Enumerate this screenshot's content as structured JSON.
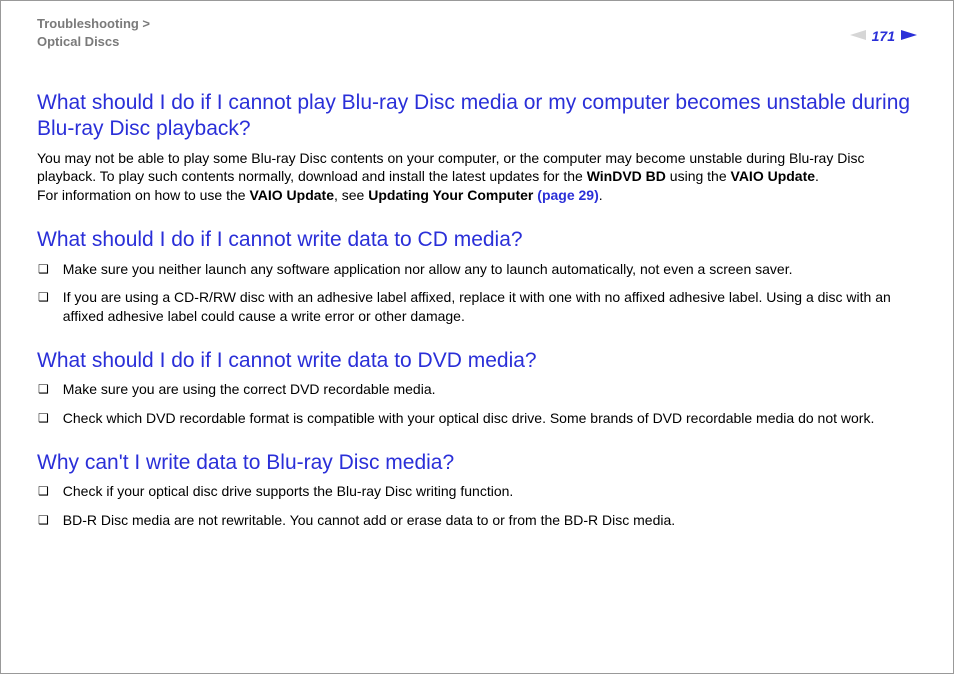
{
  "header": {
    "breadcrumb_line1": "Troubleshooting >",
    "breadcrumb_line2": "Optical Discs",
    "page_number": "171"
  },
  "sections": [
    {
      "heading": "What should I do if I cannot play Blu-ray Disc media or my computer becomes unstable during Blu-ray Disc playback?",
      "para_parts": [
        {
          "t": "You may not be able to play some Blu-ray Disc contents on your computer, or the computer may become unstable during Blu-ray Disc playback. To play such contents normally, download and install the latest updates for the "
        },
        {
          "t": "WinDVD BD",
          "bold": true
        },
        {
          "t": " using the "
        },
        {
          "t": "VAIO Update",
          "bold": true
        },
        {
          "t": "."
        },
        {
          "br": true
        },
        {
          "t": "For information on how to use the "
        },
        {
          "t": "VAIO Update",
          "bold": true
        },
        {
          "t": ", see "
        },
        {
          "t": "Updating Your Computer ",
          "bold": true
        },
        {
          "t": "(page 29)",
          "link": true
        },
        {
          "t": "."
        }
      ]
    },
    {
      "heading": "What should I do if I cannot write data to CD media?",
      "bullets": [
        "Make sure you neither launch any software application nor allow any to launch automatically, not even a screen saver.",
        "If you are using a CD-R/RW disc with an adhesive label affixed, replace it with one with no affixed adhesive label. Using a disc with an affixed adhesive label could cause a write error or other damage."
      ]
    },
    {
      "heading": "What should I do if I cannot write data to DVD media?",
      "bullets": [
        "Make sure you are using the correct DVD recordable media.",
        "Check which DVD recordable format is compatible with your optical disc drive. Some brands of DVD recordable media do not work."
      ]
    },
    {
      "heading": "Why can't I write data to Blu-ray Disc media?",
      "bullets": [
        "Check if your optical disc drive supports the Blu-ray Disc writing function.",
        "BD-R Disc media are not rewritable. You cannot add or erase data to or from the BD-R Disc media."
      ]
    }
  ]
}
